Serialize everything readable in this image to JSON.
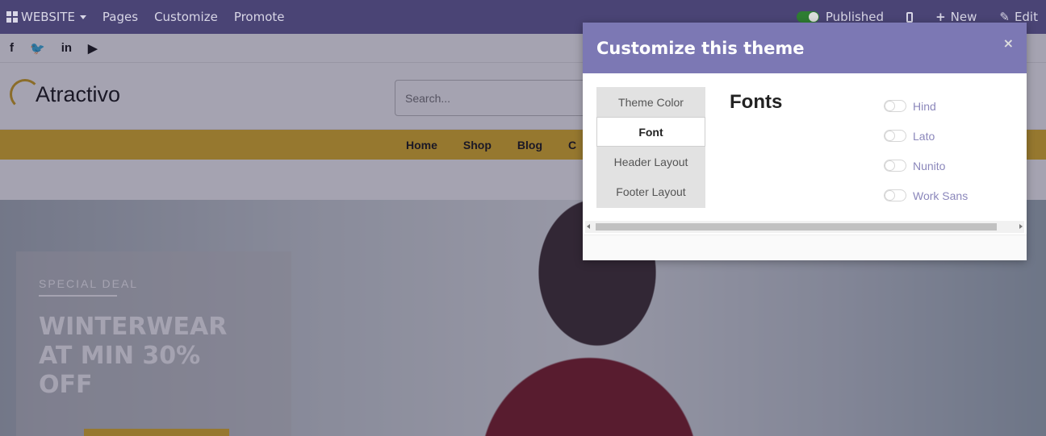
{
  "admin_bar": {
    "website_label": "WEBSITE",
    "menu": [
      "Pages",
      "Customize",
      "Promote"
    ],
    "published_label": "Published",
    "new_label": "New",
    "edit_label": "Edit"
  },
  "site": {
    "social_icons": [
      "facebook-icon",
      "twitter-icon",
      "linkedin-icon",
      "youtube-icon"
    ],
    "social_glyphs": [
      "f",
      "🐦",
      "in",
      "▶"
    ],
    "brand": "Atractivo",
    "search_placeholder": "Search...",
    "nav": [
      "Home",
      "Shop",
      "Blog",
      "C"
    ],
    "hero": {
      "eyebrow": "SPECIAL DEAL",
      "title": "WINTERWEAR AT MIN 30% OFF"
    }
  },
  "modal": {
    "title": "Customize this theme",
    "close": "×",
    "tabs": [
      "Theme Color",
      "Font",
      "Header Layout",
      "Footer Layout"
    ],
    "active_tab": "Font",
    "section_heading": "Fonts",
    "fonts": [
      "Hind",
      "Lato",
      "Nunito",
      "Work Sans"
    ]
  },
  "colors": {
    "admin_bar": "#4a4475",
    "modal_header": "#7c78b4",
    "accent": "#e6b520",
    "font_label": "#8b87bb"
  }
}
